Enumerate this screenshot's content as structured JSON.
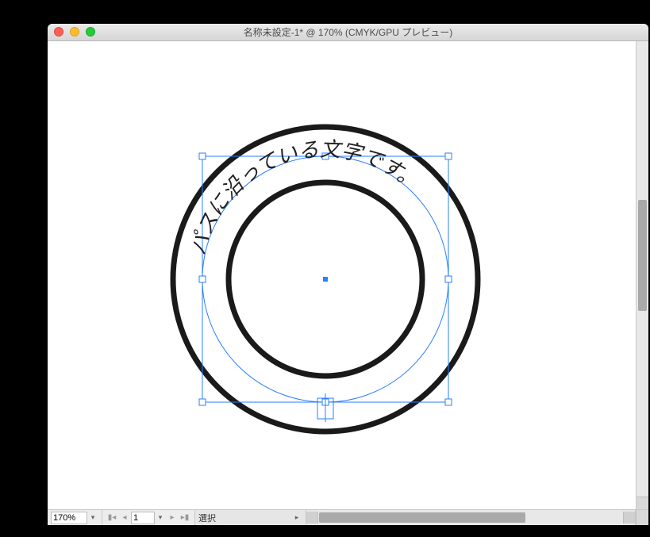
{
  "window": {
    "title": "名称未設定-1* @ 170% (CMYK/GPU プレビュー)"
  },
  "statusbar": {
    "zoom": "170%",
    "page": "1",
    "tool": "選択"
  },
  "artwork": {
    "path_text": "パスに沿っている文字です。",
    "outer_stroke": "#1a1a1a",
    "inner_stroke": "#1a1a1a",
    "selection_color": "#2a7fff",
    "text_color": "#222222"
  }
}
